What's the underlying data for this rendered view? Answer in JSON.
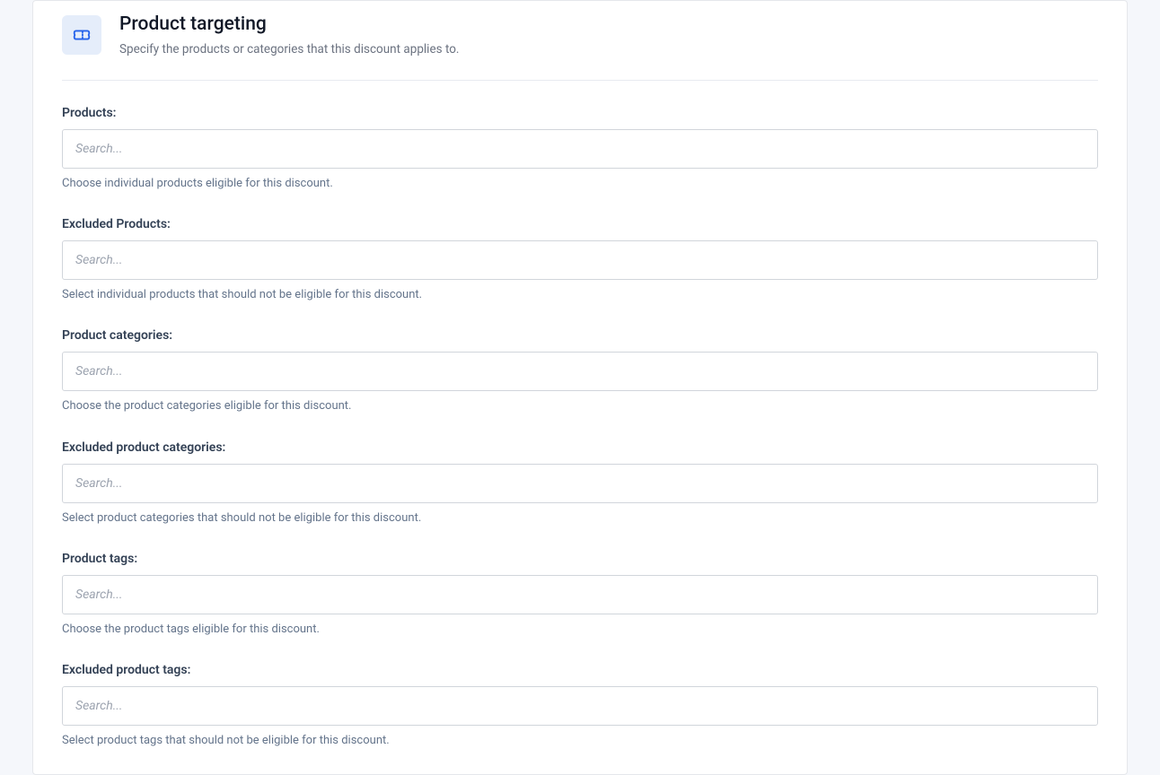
{
  "header": {
    "title": "Product targeting",
    "subtitle": "Specify the products or categories that this discount applies to."
  },
  "fields": {
    "products": {
      "label": "Products:",
      "placeholder": "Search...",
      "help": "Choose individual products eligible for this discount."
    },
    "excluded_products": {
      "label": "Excluded Products:",
      "placeholder": "Search...",
      "help": "Select individual products that should not be eligible for this discount."
    },
    "product_categories": {
      "label": "Product categories:",
      "placeholder": "Search...",
      "help": "Choose the product categories eligible for this discount."
    },
    "excluded_product_categories": {
      "label": "Excluded product categories:",
      "placeholder": "Search...",
      "help": "Select product categories that should not be eligible for this discount."
    },
    "product_tags": {
      "label": "Product tags:",
      "placeholder": "Search...",
      "help": "Choose the product tags eligible for this discount."
    },
    "excluded_product_tags": {
      "label": "Excluded product tags:",
      "placeholder": "Search...",
      "help": "Select product tags that should not be eligible for this discount."
    }
  }
}
